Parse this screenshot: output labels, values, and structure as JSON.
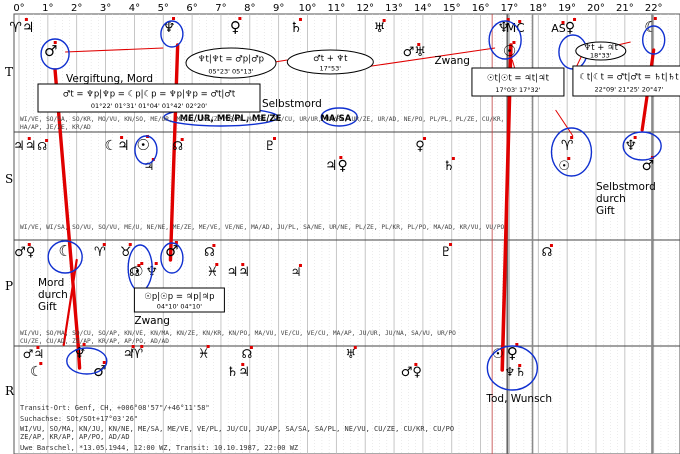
{
  "title": "",
  "degree_labels": [
    "0°",
    "1°",
    "2°",
    "3°",
    "4°",
    "5°",
    "6°",
    "7°",
    "8°",
    "9°",
    "10°",
    "11°",
    "12°",
    "13°",
    "14°",
    "15°",
    "16°",
    "17°",
    "18°",
    "19°",
    "20°",
    "21°",
    "22°"
  ],
  "row_labels": [
    "T",
    "S",
    "P",
    "R"
  ],
  "colors": {
    "accent": "#e00000",
    "circle": "#1030d0",
    "grid": "#b8b8b8"
  },
  "symbols": {
    "T": [
      {
        "deg": 0.1,
        "glyph": "♈♃",
        "size": 14
      },
      {
        "deg": 5.2,
        "glyph": "♆",
        "size": 15
      },
      {
        "deg": 7.5,
        "glyph": "♀",
        "size": 15
      },
      {
        "deg": 9.6,
        "glyph": "♄",
        "size": 14
      },
      {
        "deg": 12.5,
        "glyph": "♅",
        "size": 13
      },
      {
        "deg": 13.7,
        "glyph": "♂♅",
        "size": 13
      },
      {
        "deg": 16.8,
        "glyph": "♆",
        "size": 14
      },
      {
        "deg": 17.2,
        "glyph": "MC",
        "size": 12
      },
      {
        "deg": 18.7,
        "glyph": "AS",
        "size": 11
      },
      {
        "deg": 19.1,
        "glyph": "♀",
        "size": 14
      },
      {
        "deg": 21.9,
        "glyph": "☾",
        "size": 15
      },
      {
        "deg": 1.1,
        "glyph": "♂",
        "size": 15
      },
      {
        "deg": 17.0,
        "glyph": "☉",
        "size": 15
      },
      {
        "deg": 19.6,
        "glyph": "♃",
        "size": 13
      }
    ],
    "S": [
      {
        "deg": 0.2,
        "glyph": "♃♃",
        "size": 13
      },
      {
        "deg": 0.8,
        "glyph": "☊",
        "size": 11
      },
      {
        "deg": 3.4,
        "glyph": "☾♃",
        "size": 14
      },
      {
        "deg": 4.3,
        "glyph": "☉",
        "size": 15
      },
      {
        "deg": 5.5,
        "glyph": "☊",
        "size": 12
      },
      {
        "deg": 4.5,
        "glyph": "♃",
        "size": 12
      },
      {
        "deg": 8.7,
        "glyph": "♇",
        "size": 13
      },
      {
        "deg": 11.0,
        "glyph": "♃♀",
        "size": 14
      },
      {
        "deg": 13.9,
        "glyph": "♀",
        "size": 13
      },
      {
        "deg": 14.9,
        "glyph": "♄",
        "size": 13
      },
      {
        "deg": 19.0,
        "glyph": "♈",
        "size": 14
      },
      {
        "deg": 18.9,
        "glyph": "☉",
        "size": 13
      },
      {
        "deg": 21.2,
        "glyph": "♆",
        "size": 14
      },
      {
        "deg": 21.8,
        "glyph": "♂",
        "size": 14
      }
    ],
    "P": [
      {
        "deg": 0.2,
        "glyph": "♂♀",
        "size": 13
      },
      {
        "deg": 1.6,
        "glyph": "☾",
        "size": 15
      },
      {
        "deg": 2.8,
        "glyph": "♈",
        "size": 13
      },
      {
        "deg": 3.7,
        "glyph": "♉",
        "size": 13
      },
      {
        "deg": 4.0,
        "glyph": "☊",
        "size": 12
      },
      {
        "deg": 4.1,
        "glyph": "☉",
        "size": 14
      },
      {
        "deg": 4.6,
        "glyph": "♆",
        "size": 14
      },
      {
        "deg": 5.3,
        "glyph": "♂",
        "size": 15
      },
      {
        "deg": 6.6,
        "glyph": "☊",
        "size": 12
      },
      {
        "deg": 6.7,
        "glyph": "♓",
        "size": 13
      },
      {
        "deg": 7.6,
        "glyph": "♃♃",
        "size": 13
      },
      {
        "deg": 9.6,
        "glyph": "♃",
        "size": 12
      },
      {
        "deg": 14.8,
        "glyph": "♇",
        "size": 13
      },
      {
        "deg": 18.3,
        "glyph": "☊",
        "size": 12
      }
    ],
    "R": [
      {
        "deg": 0.5,
        "glyph": "♂♃",
        "size": 12
      },
      {
        "deg": 0.6,
        "glyph": "☾",
        "size": 14
      },
      {
        "deg": 2.1,
        "glyph": "♆",
        "size": 15
      },
      {
        "deg": 2.8,
        "glyph": "♂",
        "size": 15
      },
      {
        "deg": 3.8,
        "glyph": "♃",
        "size": 13
      },
      {
        "deg": 4.1,
        "glyph": "♈",
        "size": 13
      },
      {
        "deg": 6.4,
        "glyph": "♓",
        "size": 13
      },
      {
        "deg": 7.9,
        "glyph": "☊",
        "size": 12
      },
      {
        "deg": 7.6,
        "glyph": "♄♃",
        "size": 13
      },
      {
        "deg": 11.5,
        "glyph": "♅",
        "size": 12
      },
      {
        "deg": 13.6,
        "glyph": "♂♀",
        "size": 13
      },
      {
        "deg": 16.6,
        "glyph": "☉",
        "size": 13
      },
      {
        "deg": 17.1,
        "glyph": "♀",
        "size": 15
      },
      {
        "deg": 17.2,
        "glyph": "♆♄",
        "size": 12
      }
    ]
  },
  "annotations": {
    "vergiftung_mord": "Vergiftung, Mord",
    "selbstmord": "Selbstmord",
    "zwang_t": "Zwang",
    "mord_durch_gift": "Mord\ndurch\nGift",
    "zwang_p": "Zwang",
    "selbstmord_gift": "Selbstmord\ndurch\nGift",
    "tod_wunsch": "Tod, Wunsch"
  },
  "boxes": {
    "t_left_eq": {
      "line1": "♂t = ♆p|♆p = ☾p|☾p = ♆p|♆p = ♂t|♂t",
      "line2": "01°22'      01°31'      01°04'      01°42'      02°20'"
    },
    "t_psi": {
      "line1": "♆t|♆t = ♂p|♂p",
      "line2": "05°23'    05°13'"
    },
    "t_mars": {
      "line1": "♂t + ♆t",
      "line2": "17°53'"
    },
    "t_sun": {
      "line1": "☉t|☉t = ♃t|♃t",
      "line2": "17°03'      17°32'"
    },
    "t_psi_plus": {
      "line1": "♆t + ♃t",
      "line2": "18°33'"
    },
    "t_moon": {
      "line1": "☾t|☾t = ♂t|♂t = ♄t|♄t",
      "line2": "22°09'      21°25'      20°47'"
    },
    "p_sun": {
      "line1": "☉p|☉p = ♃p|♃p",
      "line2": "04°10'      04°10'"
    },
    "highlight_me": "ME/UR, ME/PL, ME/ZE",
    "highlight_ma": "MA/SA"
  },
  "code_rows": {
    "T": "WI/VE,  SO/SA,  SO/KR,  MO/VU,  KN/SO,  ME/UR, ME/PL, ME/ZE  VE/NE  MA/SA,  SA/CU,  UR/UR,  UR/PL,  UR/ZE,  UR/AD,  NE/PO,  PL/PL,  PL/ZE,  CU/KR,\nHA/AP,  JE/ZE,  KR/AD",
    "S": "WI/VE,  WI/SA,  SO/VU,  SO/VU,  ME/U,  NE/NE,  ME/ZE,  ME/VE,  VE/NE,  MA/AD,  JU/PL,  SA/NE,  UR/NE,  PL/ZE,  PL/KR,  PL/PO,  MA/AD,  KR/VU,  VU/PO",
    "P": "WI/VU,  SO/MA,  SO/CU,  SO/AP,  KN/VE,  KN/MA,  KN/ZE,  KN/KR,  KN/PO,  MA/VU,  VE/CU,  VE/CU,  MA/AP,  JU/UR,  JU/NA,  SA/VU,  UR/PO\nCU/ZE,  CU/AD,  ZE/AP,  KR/AP,  AP/PO,  AD/AD",
    "R": "WI/VU,  SO/MA,  KN/JU,  KN/NE,  ME/SA,  ME/SA,  ME/VE,  VE/PL,  JU/CU,  JU/AP,  SA/SA,  SA/PL,  NE/VU,  CU/ZE,  CU/KR,  CU/PO\nZE/AP,  KR/AP,  AP/PO,  AD/AD"
  },
  "footer": {
    "line1": "Transit-Ort: Genf, CH, +006°08'57\"/+46°11'58\"",
    "line2": "Suchachse: SOt/SOt+17°03'26\"",
    "line3": "WI/VU, SO/MA, KN/JU, KN/NE, ME/SA, ME/VE, VE/PL, JU/CU, JU/AP, SA/SA, SA/PL, NE/VU, CU/ZE, CU/KR, CU/PO",
    "line4": "ZE/AP, KR/AP, AP/PO, AD/AD",
    "line5": "Uwe Barschel, *13.05.1944, 12:00 WZ, Transit: 10.10.1987, 22:00 WZ"
  }
}
